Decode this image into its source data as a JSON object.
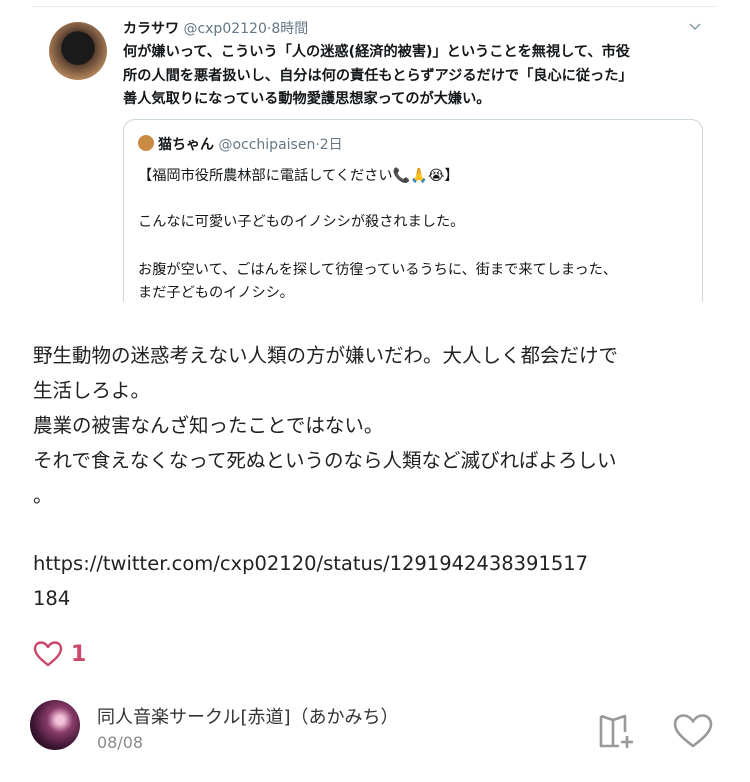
{
  "embedded_tweet": {
    "author_name": "カラサワ",
    "author_handle": "@cxp02120",
    "separator": "·",
    "time": "8時間",
    "body_lines": [
      "何が嫌いって、こういう「人の迷惑(経済的被害)」ということを無視して、市役",
      "所の人間を悪者扱いし、自分は何の責任もとらずアジるだけで「良心に従った」",
      "善人気取りになっている動物愛護思想家ってのが大嫌い。"
    ],
    "quoted": {
      "author_name": "猫ちゃん",
      "author_handle": "@occhipaisen",
      "separator": "·",
      "time": "2日",
      "lines": [
        "【福岡市役所農林部に電話してください📞🙏😭】",
        "こんなに可愛い子どものイノシシが殺されました。",
        "お腹が空いて、ごはんを探して彷徨っているうちに、街まで来てしまった、",
        "まだ子どものイノシシ。"
      ]
    }
  },
  "post": {
    "lines": [
      "野生動物の迷惑考えない人類の方が嫌いだわ。大人しく都会だけで",
      "生活しろよ。",
      "農業の被害なんざ知ったことではない。",
      "それで食えなくなって死ぬというのなら人類など滅びればよろしい",
      "。"
    ],
    "link_lines": [
      "https://twitter.com/cxp02120/status/1291942438391517",
      "184"
    ]
  },
  "likes": {
    "count": "1",
    "icon": "heart-outline-icon",
    "color": "#c9486b"
  },
  "footer": {
    "blog_name": "同人音楽サークル[赤道]（あかみち）",
    "date": "08/08",
    "icons": [
      "reblog-icon",
      "like-icon"
    ]
  }
}
